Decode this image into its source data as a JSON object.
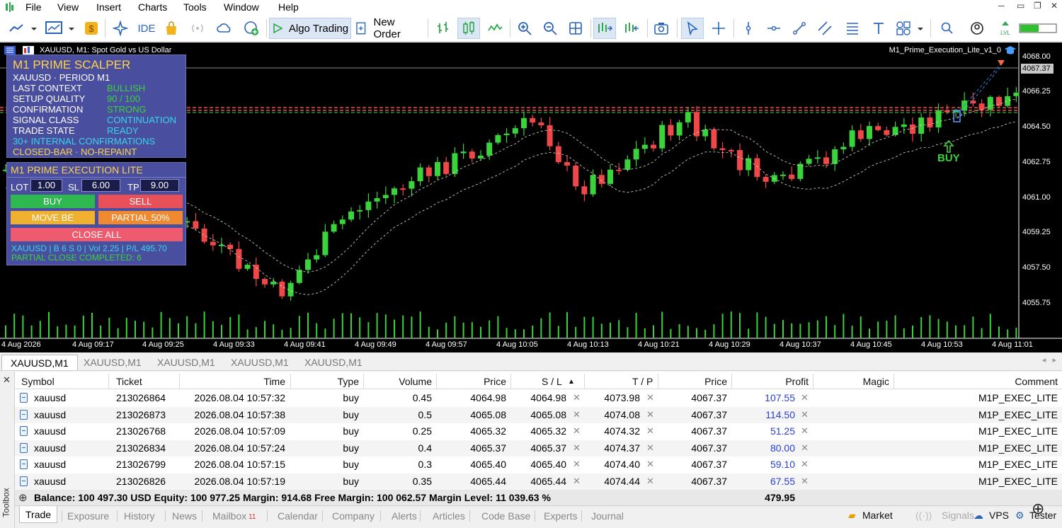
{
  "menu": [
    "File",
    "View",
    "Insert",
    "Charts",
    "Tools",
    "Window",
    "Help"
  ],
  "toolbar": {
    "algo_trading": "Algo Trading",
    "new_order": "New Order",
    "ide": "IDE"
  },
  "chart": {
    "title": "XAUUSD, M1:  Spot Gold vs US Dollar",
    "ea_label": "M1_Prime_Execution_Lite_v1_0",
    "current_price": "4067.37",
    "price_ticks": [
      "4068.00",
      "4066.25",
      "4064.50",
      "4062.75",
      "4061.00",
      "4059.25",
      "4057.50",
      "4055.75"
    ],
    "time_ticks": [
      "4 Aug 2026",
      "4 Aug 09:17",
      "4 Aug 09:25",
      "4 Aug 09:33",
      "4 Aug 09:41",
      "4 Aug 09:49",
      "4 Aug 09:57",
      "4 Aug 10:05",
      "4 Aug 10:13",
      "4 Aug 10:21",
      "4 Aug 10:29",
      "4 Aug 10:37",
      "4 Aug 10:45",
      "4 Aug 10:53",
      "4 Aug 11:01"
    ],
    "buy_signal": "BUY",
    "colors": {
      "bull": "#3bd33b",
      "bear": "#f04848",
      "bg": "#000000"
    }
  },
  "scalper_panel": {
    "title": "M1 PRIME SCALPER",
    "line1": "XAUUSD · PERIOD M1",
    "rows": [
      {
        "label": "LAST CONTEXT",
        "value": "BULLISH"
      },
      {
        "label": "SETUP QUALITY",
        "value": "90 / 100"
      },
      {
        "label": "CONFIRMATION",
        "value": "STRONG"
      },
      {
        "label": "SIGNAL CLASS",
        "value": "CONTINUATION"
      },
      {
        "label": "TRADE STATE",
        "value": "READY"
      }
    ],
    "note1": "30+ INTERNAL CONFIRMATIONS",
    "note2": "CLOSED-BAR · NO-REPAINT"
  },
  "exec_panel": {
    "title": "M1 PRIME EXECUTION LITE",
    "lot_label": "LOT",
    "lot": "1.00",
    "sl_label": "SL",
    "sl": "6.00",
    "tp_label": "TP",
    "tp": "9.00",
    "buy": "BUY",
    "sell": "SELL",
    "move_be": "MOVE BE",
    "partial": "PARTIAL 50%",
    "close_all": "CLOSE ALL",
    "status": "XAUUSD | B 6 S 0 | Vol 2.25 | P/L 495.70",
    "partial_msg": "PARTIAL CLOSE COMPLETED: 6"
  },
  "chart_tabs": [
    "XAUUSD,M1",
    "XAUUSD,M1",
    "XAUUSD,M1",
    "XAUUSD,M1",
    "XAUUSD,M1"
  ],
  "table": {
    "headers": {
      "symbol": "Symbol",
      "ticket": "Ticket",
      "time": "Time",
      "type": "Type",
      "volume": "Volume",
      "price": "Price",
      "sl": "S / L",
      "tp": "T / P",
      "price2": "Price",
      "profit": "Profit",
      "magic": "Magic",
      "comment": "Comment"
    },
    "rows": [
      {
        "symbol": "xauusd",
        "ticket": "213026864",
        "time": "2026.08.04 10:57:32",
        "type": "buy",
        "volume": "0.45",
        "price": "4064.98",
        "sl": "4064.98",
        "tp": "4073.98",
        "cur": "4067.37",
        "profit": "107.55",
        "comment": "M1P_EXEC_LITE"
      },
      {
        "symbol": "xauusd",
        "ticket": "213026873",
        "time": "2026.08.04 10:57:38",
        "type": "buy",
        "volume": "0.5",
        "price": "4065.08",
        "sl": "4065.08",
        "tp": "4074.08",
        "cur": "4067.37",
        "profit": "114.50",
        "comment": "M1P_EXEC_LITE"
      },
      {
        "symbol": "xauusd",
        "ticket": "213026768",
        "time": "2026.08.04 10:57:09",
        "type": "buy",
        "volume": "0.25",
        "price": "4065.32",
        "sl": "4065.32",
        "tp": "4074.32",
        "cur": "4067.37",
        "profit": "51.25",
        "comment": "M1P_EXEC_LITE"
      },
      {
        "symbol": "xauusd",
        "ticket": "213026834",
        "time": "2026.08.04 10:57:24",
        "type": "buy",
        "volume": "0.4",
        "price": "4065.37",
        "sl": "4065.37",
        "tp": "4074.37",
        "cur": "4067.37",
        "profit": "80.00",
        "comment": "M1P_EXEC_LITE"
      },
      {
        "symbol": "xauusd",
        "ticket": "213026799",
        "time": "2026.08.04 10:57:15",
        "type": "buy",
        "volume": "0.3",
        "price": "4065.40",
        "sl": "4065.40",
        "tp": "4074.40",
        "cur": "4067.37",
        "profit": "59.10",
        "comment": "M1P_EXEC_LITE"
      },
      {
        "symbol": "xauusd",
        "ticket": "213026826",
        "time": "2026.08.04 10:57:19",
        "type": "buy",
        "volume": "0.35",
        "price": "4065.44",
        "sl": "4065.44",
        "tp": "4074.44",
        "cur": "4067.37",
        "profit": "67.55",
        "comment": "M1P_EXEC_LITE"
      }
    ],
    "balance_line": "Balance: 100 497.30 USD  Equity: 100 977.25  Margin: 914.68  Free Margin: 100 062.57  Margin Level: 11 039.63 %",
    "total_profit": "479.95"
  },
  "bottom_tabs": [
    "Trade",
    "Exposure",
    "History",
    "News",
    "Mailbox",
    "Calendar",
    "Company",
    "Alerts",
    "Articles",
    "Code Base",
    "Experts",
    "Journal"
  ],
  "mailbox_count": "11",
  "bottom_right": {
    "market": "Market",
    "signals": "Signals",
    "vps": "VPS",
    "tester": "Tester"
  },
  "toolbox_label": "Toolbox"
}
